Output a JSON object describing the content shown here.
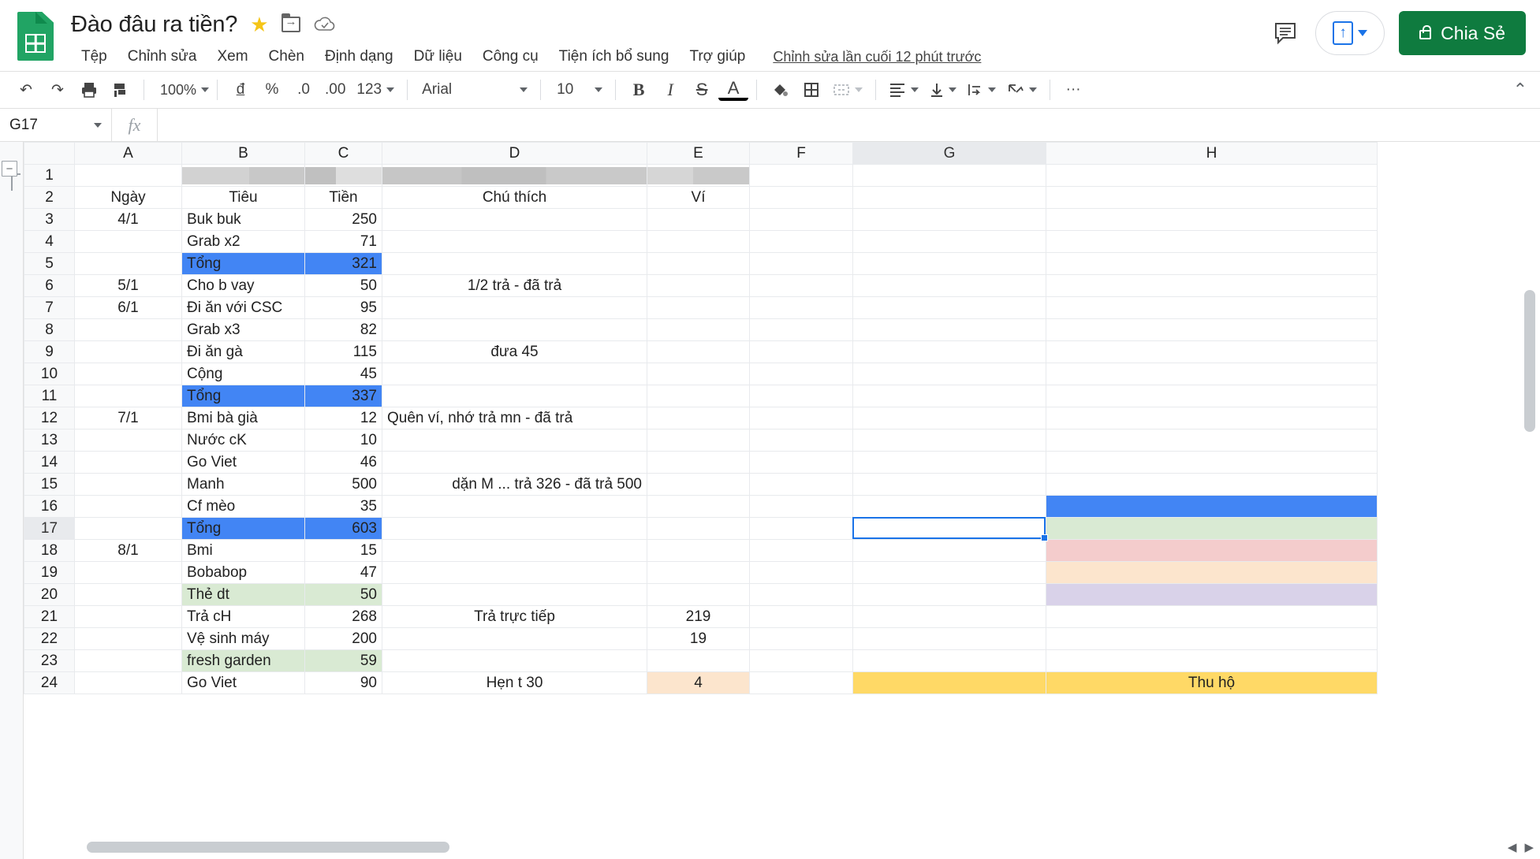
{
  "app": {
    "logo_icon": "sheets-logo-icon",
    "doc_title": "Đào đâu ra tiền?",
    "star_icon": "★",
    "move_icon": "move-to-folder-icon",
    "cloud_icon": "cloud-saved-icon",
    "last_edit": "Chỉnh sửa lần cuối 12 phút trước",
    "accent_green": "#0f7b3f",
    "accent_blue": "#1a73e8"
  },
  "menu": {
    "items": [
      {
        "label": "Tệp"
      },
      {
        "label": "Chỉnh sửa"
      },
      {
        "label": "Xem"
      },
      {
        "label": "Chèn"
      },
      {
        "label": "Định dạng"
      },
      {
        "label": "Dữ liệu"
      },
      {
        "label": "Công cụ"
      },
      {
        "label": "Tiện ích bổ sung"
      },
      {
        "label": "Trợ giúp"
      }
    ]
  },
  "top_right": {
    "comment_icon": "comment-icon",
    "present_icon": "present-icon",
    "present_caret": "▾",
    "share_label": "Chia Sẻ",
    "share_lock_icon": "lock-icon"
  },
  "toolbar": {
    "undo": "↶",
    "redo": "↷",
    "print": "print-icon",
    "paint": "paint-format-icon",
    "zoom_value": "100%",
    "currency": "đ",
    "percent": "%",
    "dec_less": ".0",
    "dec_more": ".00",
    "formats": "123",
    "font_name": "Arial",
    "font_size": "10",
    "bold": "B",
    "italic": "I",
    "strike": "S",
    "text_color": "A",
    "fill_color": "fill-color-icon",
    "borders": "borders-icon",
    "merge": "merge-cells-icon",
    "halign": "horizontal-align-icon",
    "valign": "vertical-align-icon",
    "wrap": "text-wrap-icon",
    "rotate": "text-rotation-icon",
    "more": "···",
    "collapse": "⌃"
  },
  "formula_bar": {
    "name_box": "G17",
    "fx_label": "fx",
    "formula_value": "",
    "formula_placeholder": ""
  },
  "grid": {
    "columns": [
      "A",
      "B",
      "C",
      "D",
      "E",
      "F",
      "G",
      "H"
    ],
    "selected_column": "G",
    "selected_row": "17",
    "selected_cell": "G17",
    "rows": [
      {
        "n": "1",
        "A": "",
        "B": "",
        "C": "",
        "D": "",
        "E": "",
        "F": "",
        "G": "",
        "H": "",
        "redacted": true
      },
      {
        "n": "2",
        "A": "Ngày",
        "B": "Tiêu",
        "C": "Tiền",
        "D": "Chú thích",
        "E": "Ví",
        "F": "",
        "G": "",
        "H": "",
        "header_row": true
      },
      {
        "n": "3",
        "A": "4/1",
        "B": "Buk buk",
        "C": "250",
        "D": "",
        "E": "",
        "F": "",
        "G": "",
        "H": ""
      },
      {
        "n": "4",
        "A": "",
        "B": "Grab x2",
        "C": "71",
        "D": "",
        "E": "",
        "F": "",
        "G": "",
        "H": ""
      },
      {
        "n": "5",
        "A": "",
        "B": "Tổng",
        "C": "321",
        "D": "",
        "E": "",
        "F": "",
        "G": "",
        "H": "",
        "fill": "blue"
      },
      {
        "n": "6",
        "A": "5/1",
        "B": "Cho b vay",
        "C": "50",
        "D": "1/2 trả - đã trả",
        "E": "",
        "F": "",
        "G": "",
        "H": ""
      },
      {
        "n": "7",
        "A": "6/1",
        "B": "Đi ăn với CSC",
        "C": "95",
        "D": "",
        "E": "",
        "F": "",
        "G": "",
        "H": ""
      },
      {
        "n": "8",
        "A": "",
        "B": "Grab x3",
        "C": "82",
        "D": "",
        "E": "",
        "F": "",
        "G": "",
        "H": ""
      },
      {
        "n": "9",
        "A": "",
        "B": "Đi ăn gà",
        "C": "115",
        "D": "đưa 45",
        "E": "",
        "F": "",
        "G": "",
        "H": ""
      },
      {
        "n": "10",
        "A": "",
        "B": "Cộng",
        "C": "45",
        "D": "",
        "E": "",
        "F": "",
        "G": "",
        "H": ""
      },
      {
        "n": "11",
        "A": "",
        "B": "Tổng",
        "C": "337",
        "D": "",
        "E": "",
        "F": "",
        "G": "",
        "H": "",
        "fill": "blue"
      },
      {
        "n": "12",
        "A": "7/1",
        "B": "Bmi bà già",
        "C": "12",
        "D": "Quên ví, nhớ trả mn - đã trả",
        "E": "",
        "F": "",
        "G": "",
        "H": ""
      },
      {
        "n": "13",
        "A": "",
        "B": "Nước cK",
        "C": "10",
        "D": "",
        "E": "",
        "F": "",
        "G": "",
        "H": ""
      },
      {
        "n": "14",
        "A": "",
        "B": "Go Viet",
        "C": "46",
        "D": "",
        "E": "",
        "F": "",
        "G": "",
        "H": ""
      },
      {
        "n": "15",
        "A": "",
        "B": "Manh",
        "C": "500",
        "D": "dặn M ... trả 326 - đã trả 500",
        "E": "",
        "F": "",
        "G": "",
        "H": ""
      },
      {
        "n": "16",
        "A": "",
        "B": "Cf mèo",
        "C": "35",
        "D": "",
        "E": "",
        "F": "",
        "G": "",
        "H": "",
        "h_fill": "blue"
      },
      {
        "n": "17",
        "A": "",
        "B": "Tổng",
        "C": "603",
        "D": "",
        "E": "",
        "F": "",
        "G": "",
        "H": "",
        "fill": "blue",
        "h_fill": "green"
      },
      {
        "n": "18",
        "A": "8/1",
        "B": "Bmi",
        "C": "15",
        "D": "",
        "E": "",
        "F": "",
        "G": "",
        "H": "",
        "h_fill": "red"
      },
      {
        "n": "19",
        "A": "",
        "B": "Bobabop",
        "C": "47",
        "D": "",
        "E": "",
        "F": "",
        "G": "",
        "H": "",
        "h_fill": "orange"
      },
      {
        "n": "20",
        "A": "",
        "B": "Thẻ dt",
        "C": "50",
        "D": "",
        "E": "",
        "F": "",
        "G": "",
        "H": "",
        "fill": "green",
        "h_fill": "purple"
      },
      {
        "n": "21",
        "A": "",
        "B": "Trả cH",
        "C": "268",
        "D": "Trả trực tiếp",
        "E": "219",
        "F": "",
        "G": "",
        "H": ""
      },
      {
        "n": "22",
        "A": "",
        "B": "Vệ sinh máy",
        "C": "200",
        "D": "",
        "E": "19",
        "F": "",
        "G": "",
        "H": ""
      },
      {
        "n": "23",
        "A": "",
        "B": "fresh garden",
        "C": "59",
        "D": "",
        "E": "",
        "F": "",
        "G": "",
        "H": "",
        "fill": "green"
      },
      {
        "n": "24",
        "A": "",
        "B": "Go Viet",
        "C": "90",
        "D": "Hẹn t 30",
        "E": "4",
        "F": "",
        "G": "",
        "H": "Thu hộ",
        "fill_e": "peach",
        "h_fill": "yellow",
        "partial": true
      }
    ],
    "colors": {
      "total_blue": "#4285f4",
      "light_green": "#d9ead3",
      "light_red": "#f4cccc",
      "light_orange": "#fce5cd",
      "light_purple": "#d9d2e9",
      "yellow": "#ffd966"
    }
  },
  "group_control": {
    "collapse_label": "−"
  }
}
